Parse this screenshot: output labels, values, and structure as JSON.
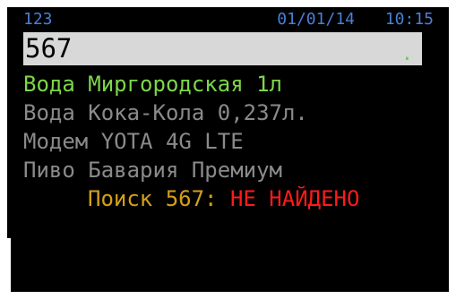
{
  "status_bar": {
    "left_text": "123",
    "date": "01/01/14",
    "time": "10:15"
  },
  "input": {
    "value": "567",
    "cursor": "."
  },
  "list": {
    "items": [
      {
        "label": "Вода Миргородская 1л",
        "selected": true
      },
      {
        "label": "Вода Кока-Кола 0,237л.",
        "selected": false
      },
      {
        "label": "Модем YOTA 4G LTE",
        "selected": false
      },
      {
        "label": "Пиво Бавария Премиум",
        "selected": false
      }
    ]
  },
  "search": {
    "label": "Поиск 567:",
    "result": "НЕ НАЙДЕНО"
  },
  "colors": {
    "background": "#000000",
    "status_text": "#4a7fd6",
    "selected_item": "#7ed64a",
    "item": "#8a8a8a",
    "search_label": "#d4a017",
    "search_result": "#ff1a1a",
    "input_background": "#d8d8d8"
  }
}
